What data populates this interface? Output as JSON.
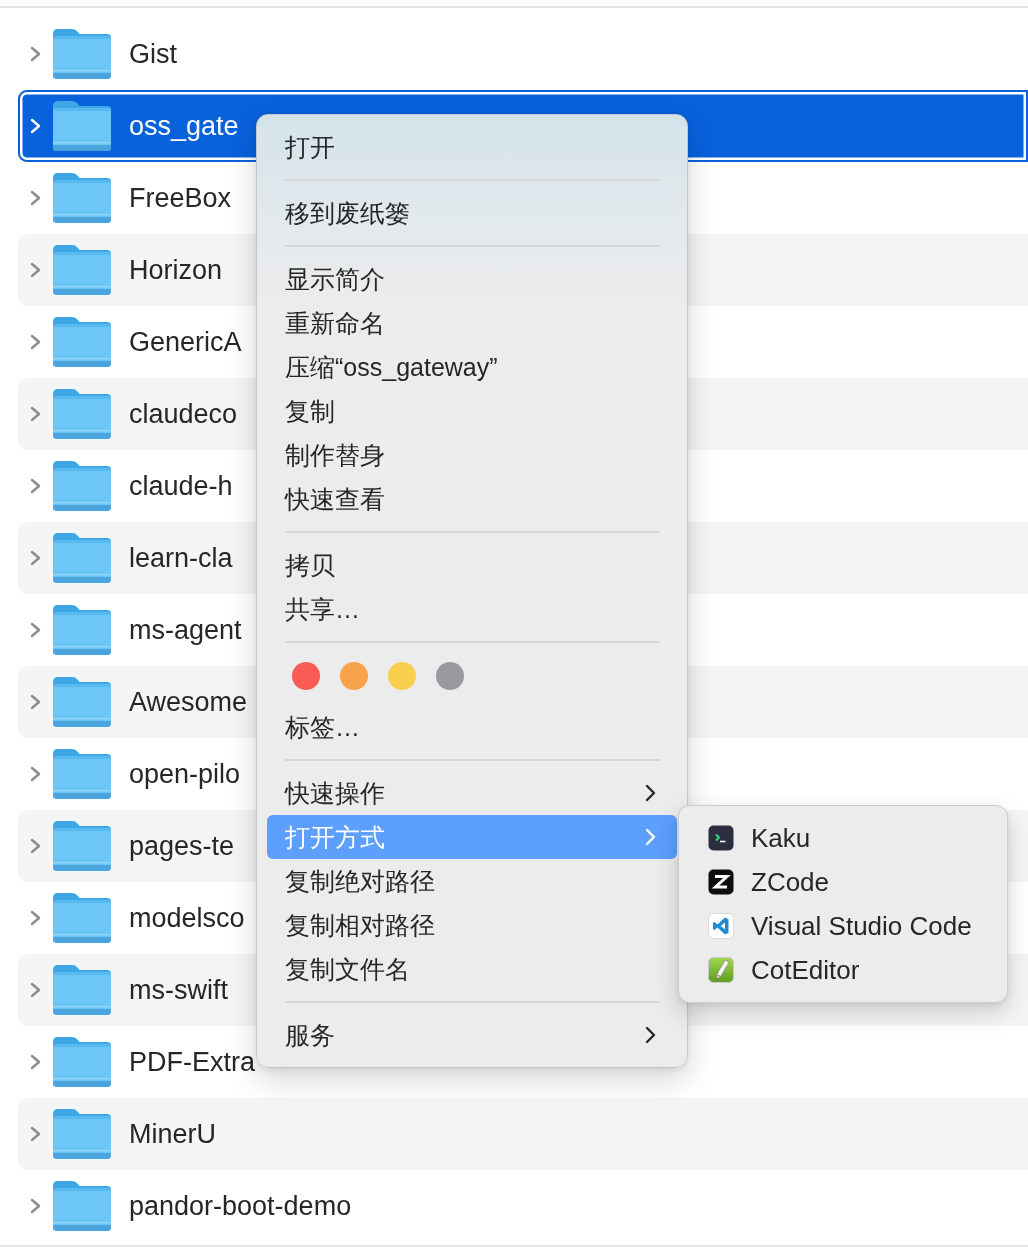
{
  "file_list": {
    "rows": [
      {
        "name": "Gist",
        "selected": false,
        "expanded": false
      },
      {
        "name": "oss_gate",
        "selected": true,
        "expanded": false
      },
      {
        "name": "FreeBox",
        "selected": false,
        "expanded": false
      },
      {
        "name": "Horizon",
        "selected": false,
        "expanded": false
      },
      {
        "name": "GenericA",
        "selected": false,
        "expanded": false
      },
      {
        "name": "claudeco",
        "selected": false,
        "expanded": false
      },
      {
        "name": "claude-h",
        "selected": false,
        "expanded": false
      },
      {
        "name": "learn-cla",
        "selected": false,
        "expanded": false
      },
      {
        "name": "ms-agent",
        "selected": false,
        "expanded": false
      },
      {
        "name": "Awesome",
        "selected": false,
        "expanded": false
      },
      {
        "name": "open-pilo",
        "selected": false,
        "expanded": false
      },
      {
        "name": "pages-te",
        "selected": false,
        "expanded": false
      },
      {
        "name": "modelsco",
        "selected": false,
        "expanded": false
      },
      {
        "name": "ms-swift",
        "selected": false,
        "expanded": false
      },
      {
        "name": "PDF-Extra",
        "selected": false,
        "expanded": false
      },
      {
        "name": "MinerU",
        "selected": false,
        "expanded": false
      },
      {
        "name": "pandor-boot-demo",
        "selected": false,
        "expanded": false
      }
    ]
  },
  "context_menu": {
    "items": [
      {
        "kind": "item",
        "label": "打开",
        "selected": false,
        "submenu": false
      },
      {
        "kind": "separator"
      },
      {
        "kind": "item",
        "label": "移到废纸篓",
        "selected": false,
        "submenu": false
      },
      {
        "kind": "separator"
      },
      {
        "kind": "item",
        "label": "显示简介",
        "selected": false,
        "submenu": false
      },
      {
        "kind": "item",
        "label": "重新命名",
        "selected": false,
        "submenu": false
      },
      {
        "kind": "item",
        "label": "压缩“oss_gateway”",
        "selected": false,
        "submenu": false
      },
      {
        "kind": "item",
        "label": "复制",
        "selected": false,
        "submenu": false
      },
      {
        "kind": "item",
        "label": "制作替身",
        "selected": false,
        "submenu": false
      },
      {
        "kind": "item",
        "label": "快速查看",
        "selected": false,
        "submenu": false
      },
      {
        "kind": "separator"
      },
      {
        "kind": "item",
        "label": "拷贝",
        "selected": false,
        "submenu": false
      },
      {
        "kind": "item",
        "label": "共享…",
        "selected": false,
        "submenu": false
      },
      {
        "kind": "separator"
      },
      {
        "kind": "tags",
        "dots": [
          {
            "color": "#f95c54"
          },
          {
            "color": "#f9a24c"
          },
          {
            "color": "#f8d04d"
          },
          {
            "color": "#9a999e"
          }
        ]
      },
      {
        "kind": "item",
        "label": "标签…",
        "selected": false,
        "submenu": false
      },
      {
        "kind": "separator"
      },
      {
        "kind": "item",
        "label": "快速操作",
        "selected": false,
        "submenu": true
      },
      {
        "kind": "item",
        "label": "打开方式",
        "selected": true,
        "submenu": true
      },
      {
        "kind": "item",
        "label": "复制绝对路径",
        "selected": false,
        "submenu": false
      },
      {
        "kind": "item",
        "label": "复制相对路径",
        "selected": false,
        "submenu": false
      },
      {
        "kind": "item",
        "label": "复制文件名",
        "selected": false,
        "submenu": false
      },
      {
        "kind": "separator"
      },
      {
        "kind": "item",
        "label": "服务",
        "selected": false,
        "submenu": true
      }
    ]
  },
  "submenu": {
    "items": [
      {
        "kind": "terminal",
        "label": "Kaku",
        "selected": false
      },
      {
        "kind": "zigzag",
        "label": "ZCode",
        "selected": false
      },
      {
        "kind": "ribbon",
        "label": "Visual Studio Code",
        "selected": false
      },
      {
        "kind": "pencil",
        "label": "CotEditor",
        "selected": false
      }
    ]
  }
}
